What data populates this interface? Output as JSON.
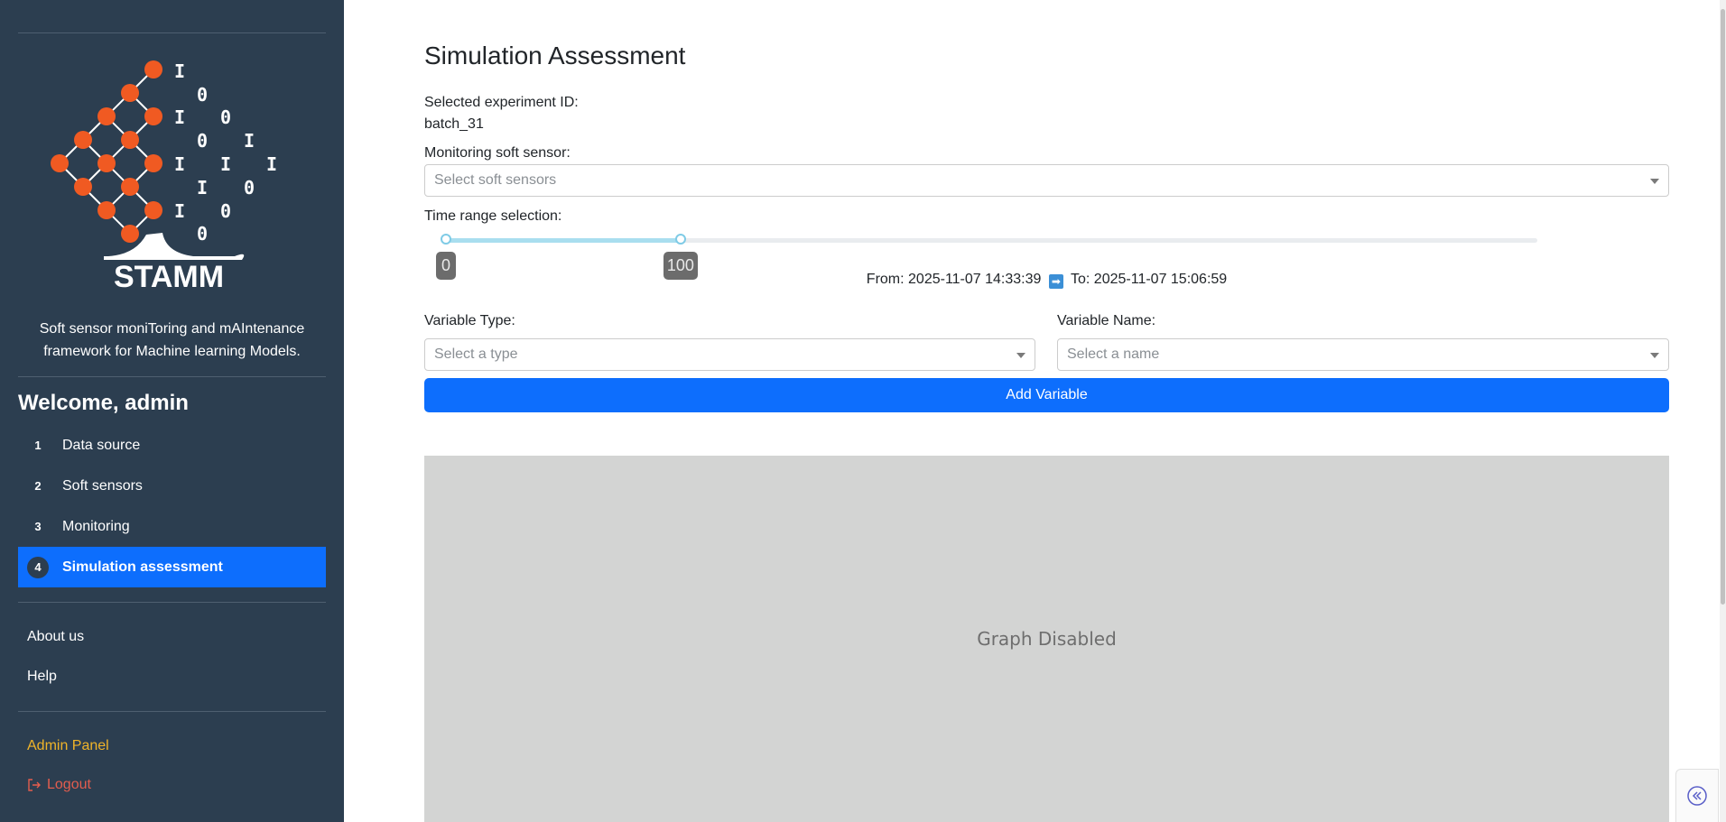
{
  "sidebar": {
    "logo_text": "STAMM",
    "tagline": "Soft sensor moniToring and mAIntenance framework for Machine learning Models.",
    "welcome": "Welcome, admin",
    "nav": [
      {
        "num": "1",
        "label": "Data source"
      },
      {
        "num": "2",
        "label": "Soft sensors"
      },
      {
        "num": "3",
        "label": "Monitoring"
      },
      {
        "num": "4",
        "label": "Simulation assessment"
      }
    ],
    "links": {
      "about": "About us",
      "help": "Help",
      "admin": "Admin Panel",
      "logout": "Logout"
    }
  },
  "main": {
    "title": "Simulation Assessment",
    "experiment_label": "Selected experiment ID:",
    "experiment_value": "batch_31",
    "soft_sensor_label": "Monitoring soft sensor:",
    "soft_sensor_placeholder": "Select soft sensors",
    "time_range_label": "Time range selection:",
    "slider": {
      "min": 0,
      "max": 100,
      "start": 0,
      "end": 100,
      "start_label": "0",
      "end_label": "100",
      "end_fraction": 0.215
    },
    "from_label": "From: 2025-11-07 14:33:39",
    "to_label": "To: 2025-11-07 15:06:59",
    "variable_type_label": "Variable Type:",
    "variable_type_placeholder": "Select a type",
    "variable_name_label": "Variable Name:",
    "variable_name_placeholder": "Select a name",
    "add_button": "Add Variable",
    "graph_text": "Graph Disabled"
  },
  "colors": {
    "sidebar_bg": "#2c3e50",
    "accent": "#0d6efd",
    "admin": "#f0b429",
    "logout": "#e35d4e",
    "logo_orange": "#f05a22"
  }
}
